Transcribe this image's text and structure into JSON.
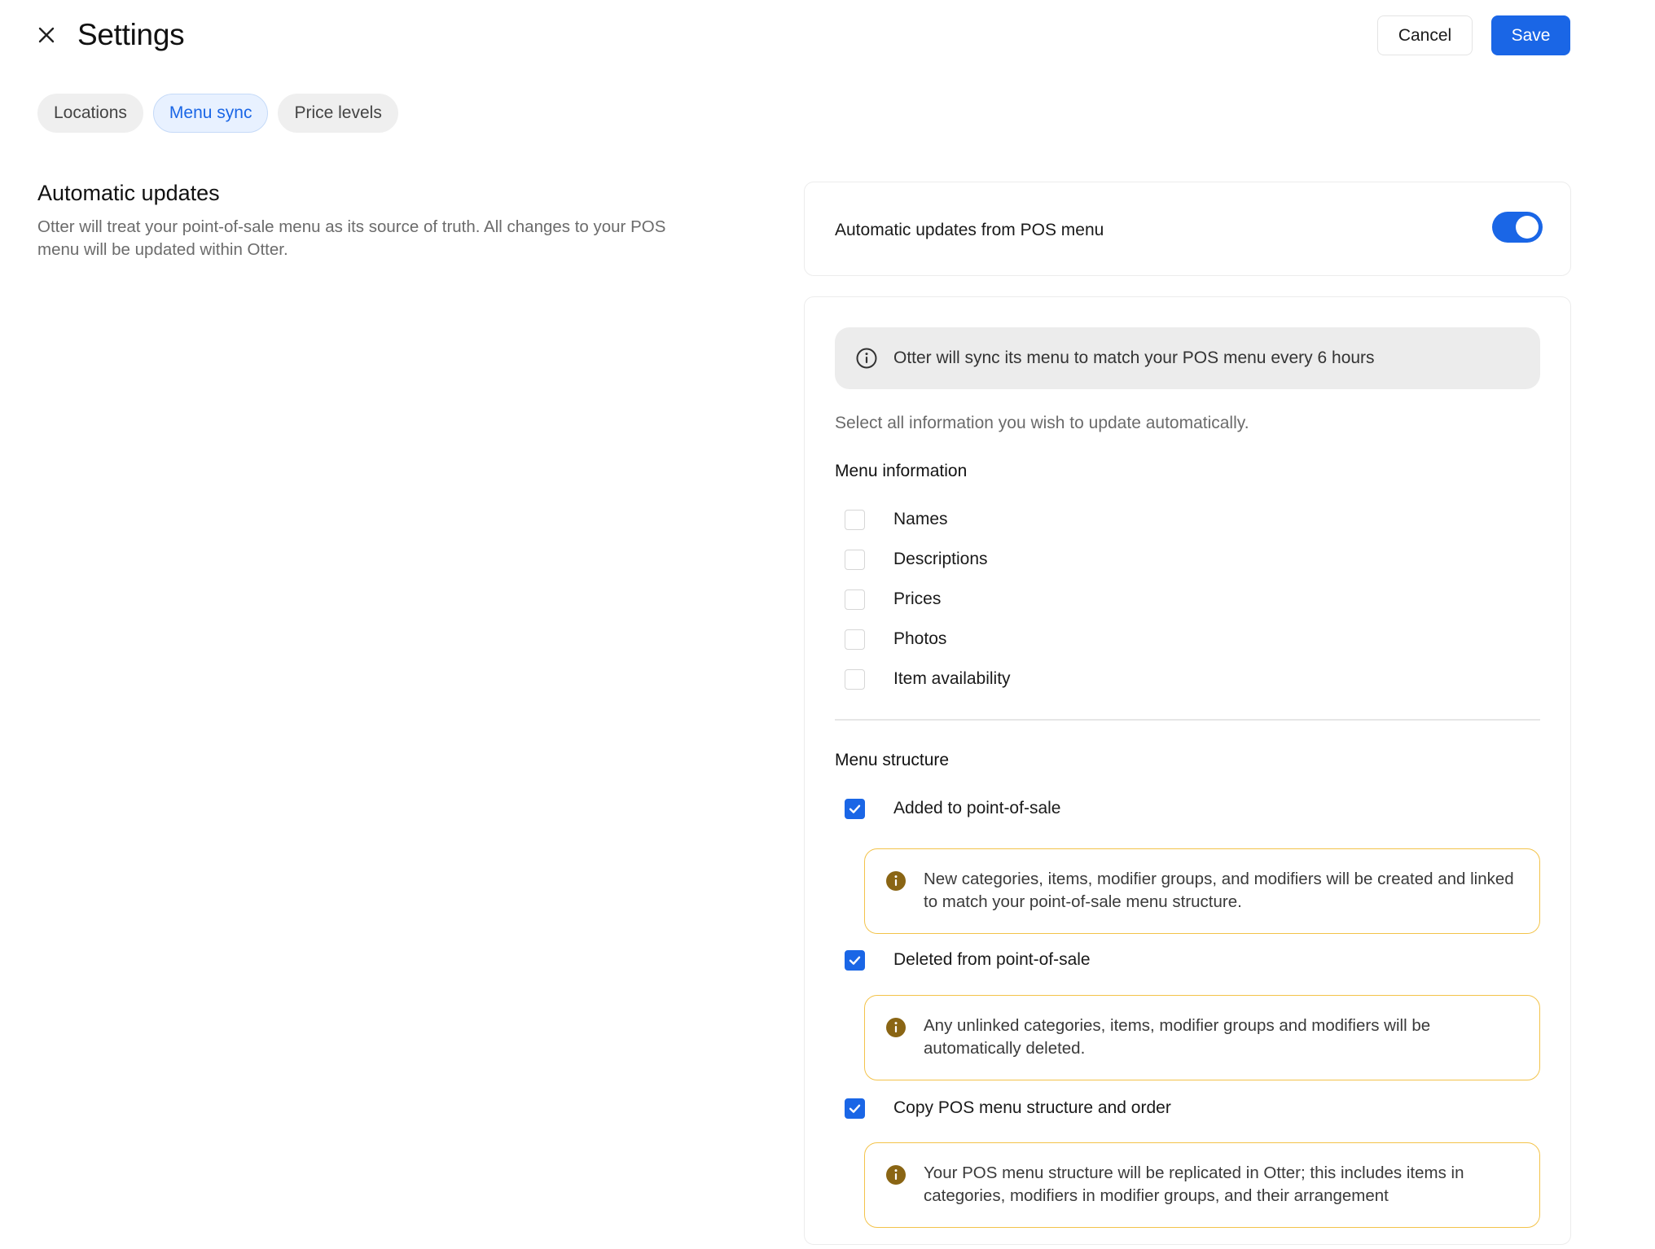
{
  "header": {
    "title": "Settings",
    "cancel_label": "Cancel",
    "save_label": "Save"
  },
  "tabs": [
    {
      "label": "Locations",
      "active": false
    },
    {
      "label": "Menu sync",
      "active": true
    },
    {
      "label": "Price levels",
      "active": false
    }
  ],
  "section": {
    "title": "Automatic updates",
    "description": "Otter will treat your point-of-sale menu as its source of truth. All changes to your POS menu will be updated within Otter."
  },
  "toggle_card": {
    "label": "Automatic updates from POS menu",
    "enabled": true
  },
  "sync": {
    "info_text": "Otter will sync its menu to match your POS menu every 6 hours",
    "helper_text": "Select all information you wish to update automatically.",
    "menu_information": {
      "title": "Menu information",
      "items": [
        {
          "label": "Names",
          "checked": false
        },
        {
          "label": "Descriptions",
          "checked": false
        },
        {
          "label": "Prices",
          "checked": false
        },
        {
          "label": "Photos",
          "checked": false
        },
        {
          "label": "Item availability",
          "checked": false
        }
      ]
    },
    "menu_structure": {
      "title": "Menu structure",
      "items": [
        {
          "label": "Added to point-of-sale",
          "checked": true,
          "note": "New categories, items, modifier groups, and modifiers will be created and linked to match your point-of-sale menu structure."
        },
        {
          "label": "Deleted from point-of-sale",
          "checked": true,
          "note": "Any unlinked categories, items, modifier groups and modifiers will be automatically deleted."
        },
        {
          "label": "Copy POS menu structure and order",
          "checked": true,
          "note": "Your POS menu structure will be replicated in Otter; this includes items in categories, modifiers in modifier groups, and their arrangement"
        }
      ]
    }
  },
  "colors": {
    "accent": "#1a66e6",
    "warning_border": "#f3c34a",
    "warning_icon": "#8a6514"
  },
  "icons": {
    "close": "close-icon",
    "info": "info-icon",
    "warning": "warning-info-icon",
    "check": "check-icon"
  }
}
